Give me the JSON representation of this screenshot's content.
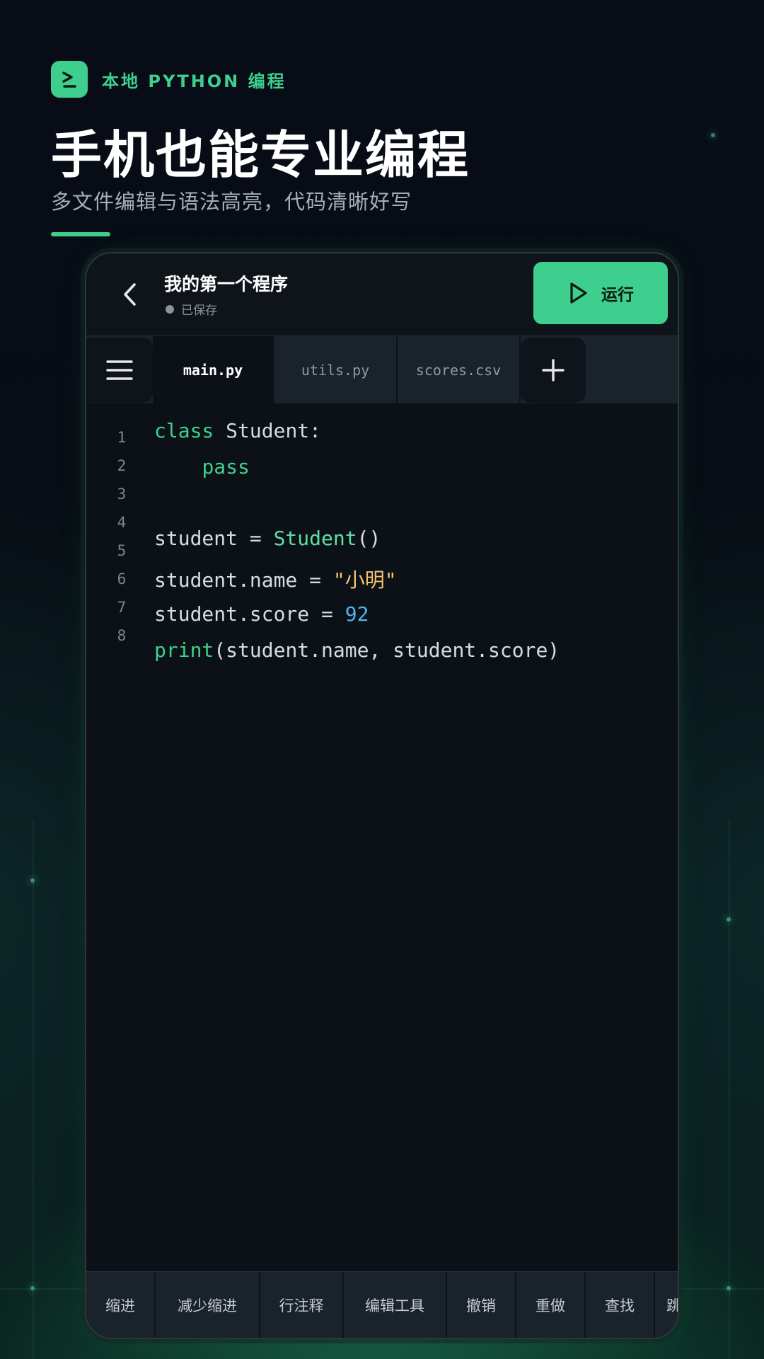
{
  "header": {
    "brand": "本地 PYTHON 编程",
    "title": "手机也能专业编程",
    "subtitle": "多文件编辑与语法高亮，代码清晰好写"
  },
  "app": {
    "doc_title": "我的第一个程序",
    "save_status": "已保存",
    "run_label": "运行"
  },
  "tabs": [
    {
      "label": "main.py",
      "active": true
    },
    {
      "label": "utils.py",
      "active": false
    },
    {
      "label": "scores.csv",
      "active": false
    }
  ],
  "editor": {
    "line_numbers": [
      "1",
      "2",
      "3",
      "4",
      "5",
      "6",
      "7",
      "8"
    ],
    "lines": [
      [
        {
          "t": "class",
          "k": "kw"
        },
        {
          "t": " Student:",
          "k": "plain"
        }
      ],
      [
        {
          "t": "    ",
          "k": "plain"
        },
        {
          "t": "pass",
          "k": "kw"
        }
      ],
      [],
      [
        {
          "t": "student = ",
          "k": "plain"
        },
        {
          "t": "Student",
          "k": "cls"
        },
        {
          "t": "()",
          "k": "plain"
        }
      ],
      [
        {
          "t": "student.name = ",
          "k": "plain"
        },
        {
          "t": "\"小明\"",
          "k": "str"
        }
      ],
      [
        {
          "t": "student.score = ",
          "k": "plain"
        },
        {
          "t": "92",
          "k": "num"
        }
      ],
      [
        {
          "t": "print",
          "k": "kw"
        },
        {
          "t": "(student.name, student.score)",
          "k": "plain"
        }
      ]
    ]
  },
  "toolbar": {
    "items": [
      "缩进",
      "减少缩进",
      "行注释",
      "编辑工具",
      "撤销",
      "重做",
      "查找",
      "跳"
    ]
  },
  "colors": {
    "accent": "#3ecf8e",
    "keyword": "#3ecf8e",
    "string": "#f2c46d",
    "number": "#4fb3f0",
    "editor_bg": "#0c1117"
  },
  "icons": {
    "brand": "terminal-prompt-icon",
    "back": "chevron-left-icon",
    "run": "play-icon",
    "menu": "hamburger-menu-icon",
    "add_tab": "plus-icon"
  }
}
